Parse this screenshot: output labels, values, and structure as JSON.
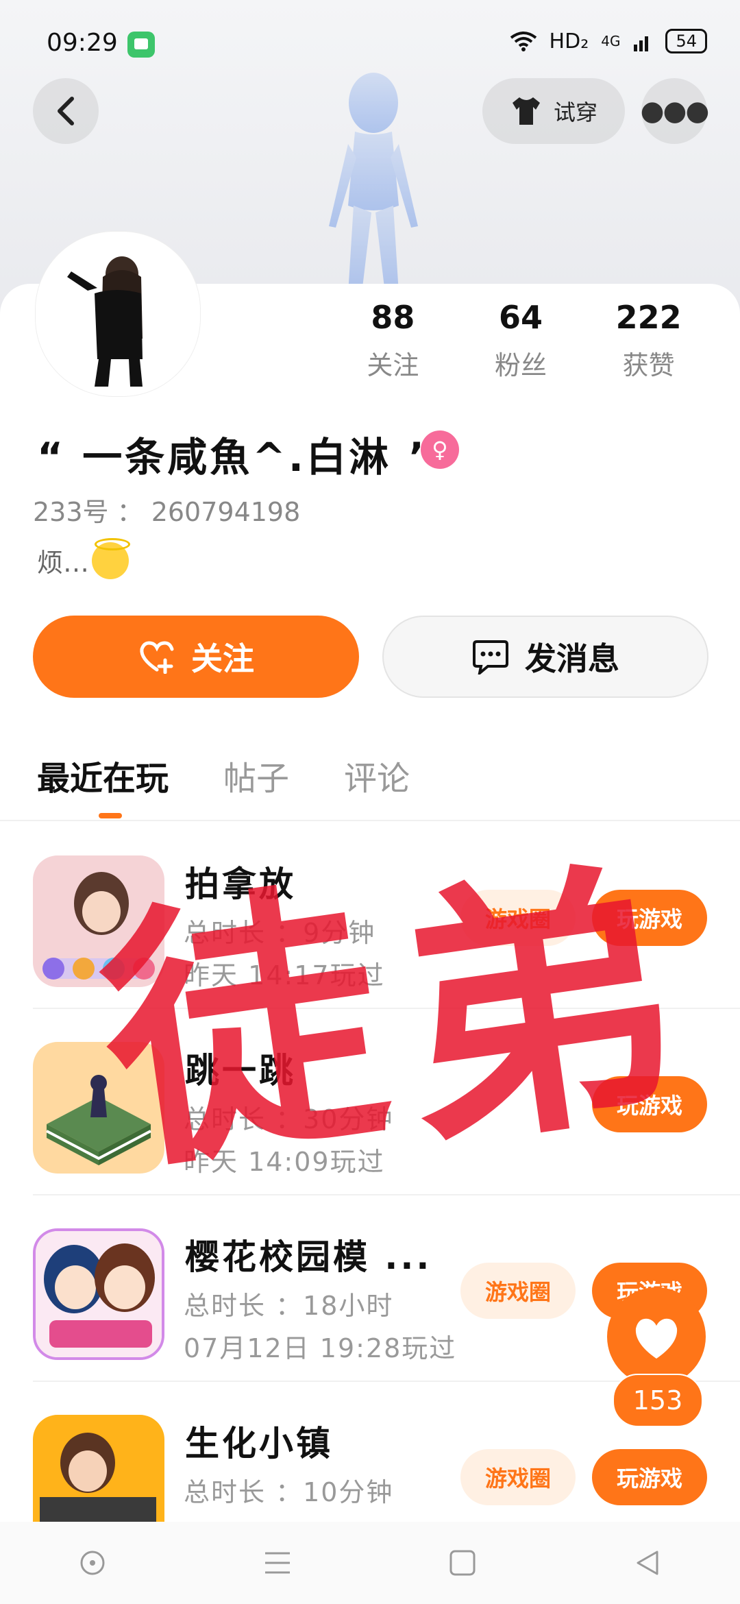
{
  "status_bar": {
    "time": "09:29",
    "network": "HD₂",
    "network_type": "4G",
    "battery": "54"
  },
  "header": {
    "try_on_label": "试穿"
  },
  "profile": {
    "stats": [
      {
        "value": "88",
        "label": "关注"
      },
      {
        "value": "64",
        "label": "粉丝"
      },
      {
        "value": "222",
        "label": "获赞"
      }
    ],
    "nickname": "“ 一条咸魚^.白淋 ”",
    "gender_symbol": "♀",
    "uid": "233号 ： 260794198",
    "bio": "烦…"
  },
  "actions": {
    "follow_label": "关注",
    "message_label": "发消息"
  },
  "tabs": [
    {
      "label": "最近在玩",
      "active": true
    },
    {
      "label": "帖子",
      "active": false
    },
    {
      "label": "评论",
      "active": false
    }
  ],
  "games": [
    {
      "title": "拍拿放",
      "total": "总时长 ：9分钟",
      "last": "昨天 14:17玩过",
      "circle": "游戏圈",
      "play": "玩游戏"
    },
    {
      "title": "跳一跳",
      "total": "总时长 ：30分钟",
      "last": "昨天 14:09玩过",
      "circle": "",
      "play": "玩游戏"
    },
    {
      "title": "樱花校园模 ...",
      "total": "总时长 ：18小时",
      "last": "07月12日 19:28玩过",
      "circle": "游戏圈",
      "play": "玩游戏"
    },
    {
      "title": "生化小镇",
      "total": "总时长 ：10分钟",
      "last": "",
      "circle": "游戏圈",
      "play": "玩游戏"
    }
  ],
  "watermark": {
    "char1": "徒",
    "char2": "弟"
  },
  "like_float": {
    "count": "153"
  },
  "colors": {
    "accent": "#ff7518",
    "text_secondary": "#999999",
    "watermark": "#e8172f"
  }
}
